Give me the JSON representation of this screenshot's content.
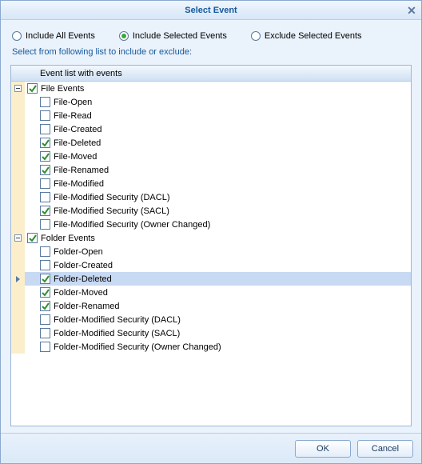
{
  "title": "Select Event",
  "radios": {
    "all": "Include All Events",
    "include": "Include Selected Events",
    "exclude": "Exclude Selected Events",
    "selected": "include"
  },
  "hint": "Select from following list to include or exclude:",
  "header": "Event list with events",
  "groups": [
    {
      "label": "File Events",
      "checked": true,
      "expanded": true,
      "items": [
        {
          "label": "File-Open",
          "checked": false
        },
        {
          "label": "File-Read",
          "checked": false
        },
        {
          "label": "File-Created",
          "checked": false
        },
        {
          "label": "File-Deleted",
          "checked": true
        },
        {
          "label": "File-Moved",
          "checked": true
        },
        {
          "label": "File-Renamed",
          "checked": true
        },
        {
          "label": "File-Modified",
          "checked": false
        },
        {
          "label": "File-Modified Security (DACL)",
          "checked": false
        },
        {
          "label": "File-Modified Security (SACL)",
          "checked": true
        },
        {
          "label": "File-Modified Security (Owner Changed)",
          "checked": false
        }
      ]
    },
    {
      "label": "Folder Events",
      "checked": true,
      "expanded": true,
      "items": [
        {
          "label": "Folder-Open",
          "checked": false
        },
        {
          "label": "Folder-Created",
          "checked": false
        },
        {
          "label": "Folder-Deleted",
          "checked": true,
          "selected": true,
          "active": true
        },
        {
          "label": "Folder-Moved",
          "checked": true
        },
        {
          "label": "Folder-Renamed",
          "checked": true
        },
        {
          "label": "Folder-Modified Security (DACL)",
          "checked": false
        },
        {
          "label": "Folder-Modified Security (SACL)",
          "checked": false
        },
        {
          "label": "Folder-Modified Security (Owner Changed)",
          "checked": false
        }
      ]
    }
  ],
  "buttons": {
    "ok": "OK",
    "cancel": "Cancel"
  }
}
